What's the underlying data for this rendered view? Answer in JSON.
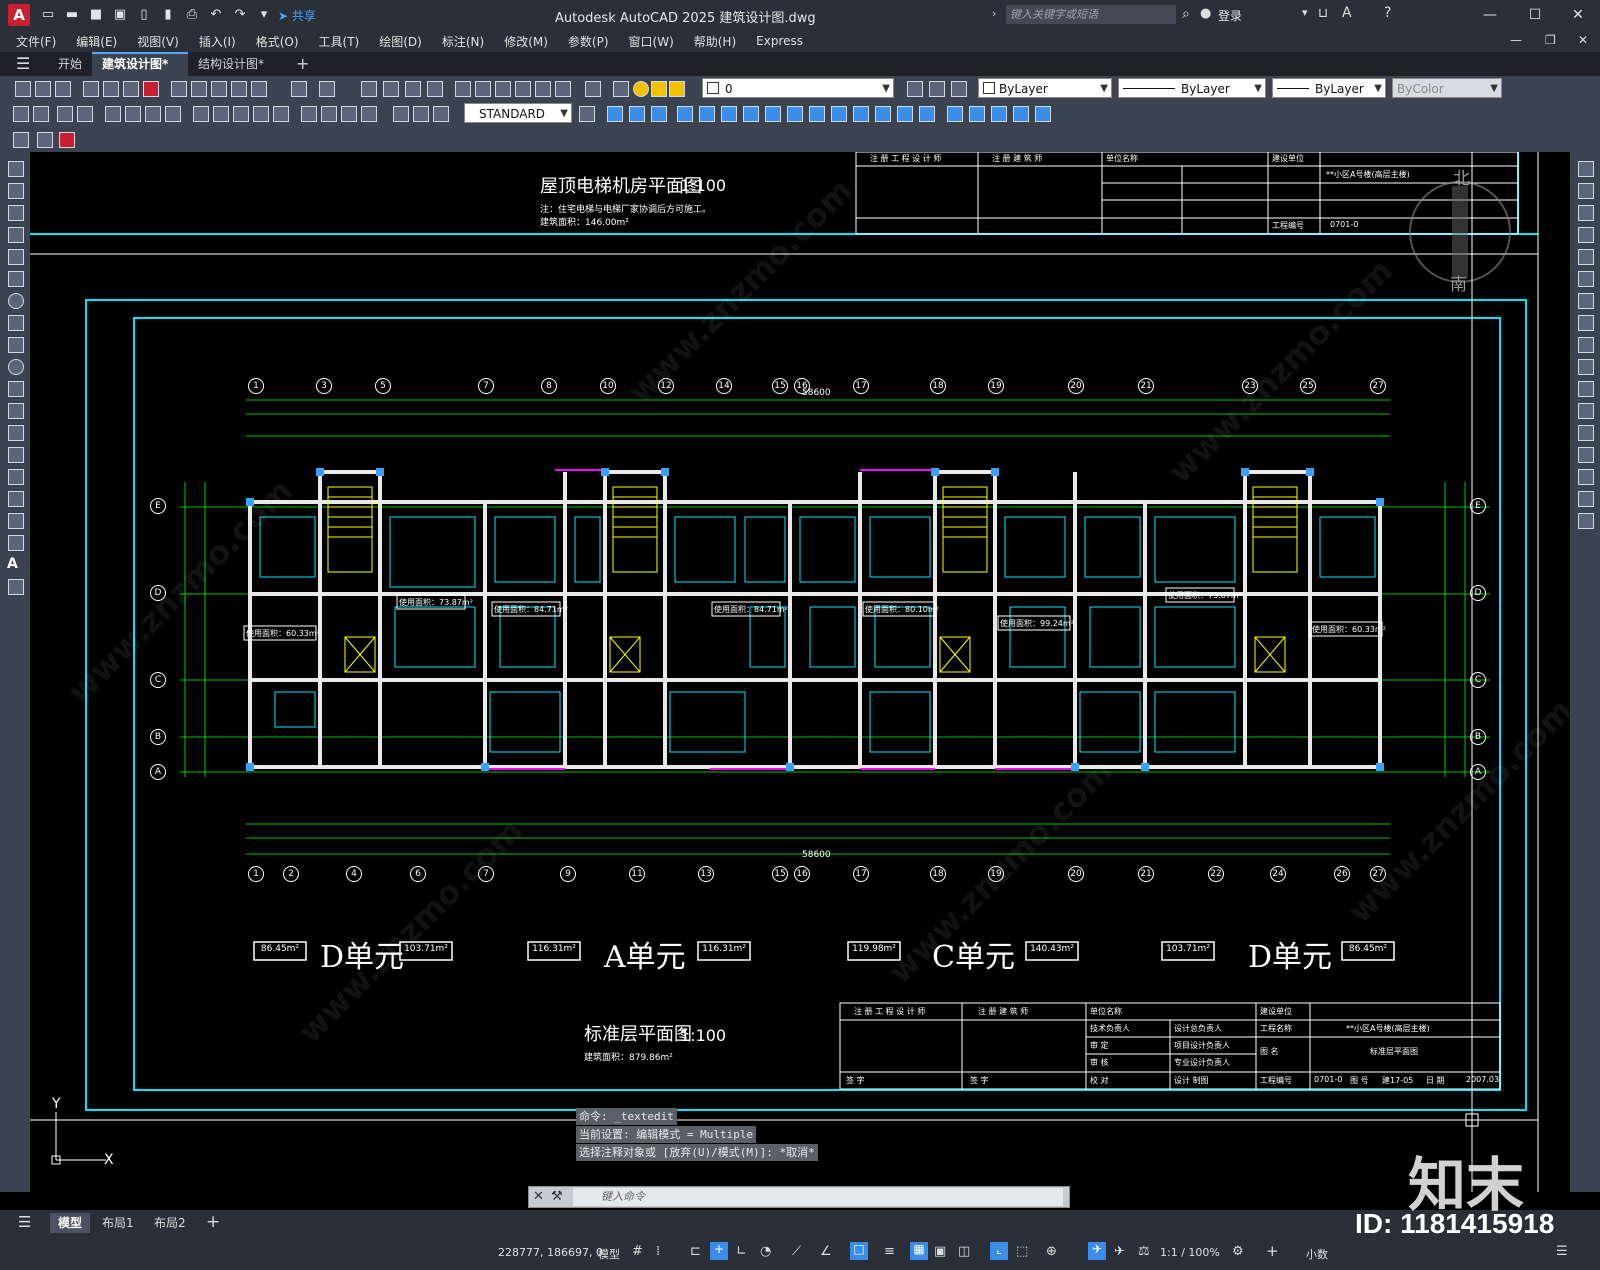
{
  "titlebar": {
    "app_logo": "A",
    "share": "共享",
    "title": "Autodesk AutoCAD 2025    建筑设计图.dwg",
    "search_placeholder": "键入关键字或短语",
    "login": "登录"
  },
  "menu": [
    "文件(F)",
    "编辑(E)",
    "视图(V)",
    "插入(I)",
    "格式(O)",
    "工具(T)",
    "绘图(D)",
    "标注(N)",
    "修改(M)",
    "参数(P)",
    "窗口(W)",
    "帮助(H)",
    "Express"
  ],
  "tabs": {
    "start": "开始",
    "doc1": "建筑设计图*",
    "doc2": "结构设计图*",
    "close": "✕",
    "add": "+"
  },
  "toolbar": {
    "layer_value": "0",
    "textstyle": "STANDARD",
    "color": "ByLayer",
    "linetype": "ByLayer",
    "lineweight": "ByLayer",
    "plotstyle": "ByColor"
  },
  "drawing": {
    "roof_title": "屋顶电梯机房平面图",
    "roof_scale": "1:100",
    "roof_note": "注：住宅电梯与电梯厂家协调后方可施工。",
    "roof_area": "建筑面积：146.00m²",
    "std_title": "标准层平面图",
    "std_scale": "1:100",
    "std_area": "建筑面积：879.86m²",
    "compass_n": "北",
    "compass_s": "南",
    "total_dim": "58600",
    "grid_top": [
      "1",
      "3",
      "5",
      "7",
      "8",
      "10",
      "12",
      "14",
      "15",
      "16",
      "17",
      "18",
      "19",
      "20",
      "21",
      "23",
      "25",
      "27"
    ],
    "grid_bottom": [
      "1",
      "2",
      "4",
      "6",
      "7",
      "9",
      "11",
      "13",
      "15",
      "16",
      "17",
      "18",
      "19",
      "20",
      "21",
      "22",
      "24",
      "26",
      "27"
    ],
    "grid_rows": [
      "E",
      "D",
      "C",
      "B",
      "A"
    ],
    "units": [
      {
        "left_area": "86.45m²",
        "name": "D单元",
        "right_area": "103.71m²"
      },
      {
        "left_area": "116.31m²",
        "name": "A单元",
        "right_area": "116.31m²"
      },
      {
        "left_area": "119.98m²",
        "name": "C单元",
        "right_area": "140.43m²"
      },
      {
        "left_area": "103.71m²",
        "name": "D单元",
        "right_area": "86.45m²"
      }
    ],
    "room_areas": [
      "使用面积：73.87m²",
      "使用面积：84.71m²",
      "使用面积：84.71m²",
      "使用面积：80.10m²",
      "使用面积：99.24m²",
      "使用面积：73.87m²",
      "使用面积：60.33m²",
      "使用面积：60.33m²"
    ],
    "titleblock": {
      "c1": "注 册 工 程 设 计 师",
      "c2": "注 册 建 筑 师",
      "c3": "单位名称",
      "c4": "建设单位",
      "r_tech": "技术负责人",
      "r_design": "设计总负责人",
      "r_project": "工程名称",
      "r_project_v": "**小区A号楼(高层主楼)",
      "r_audit": "审 定",
      "r_proj_lead": "项目设计负责人",
      "r_check": "审 核",
      "r_prof_lead": "专业设计负责人",
      "r_name": "图 名",
      "r_name_v": "标准层平面图",
      "r_sign": "签 字",
      "r_proof": "校 对",
      "r_designer": "设计 制图",
      "r_no": "工程编号",
      "r_no_v": "0701-0",
      "r_drawno": "图 号",
      "r_drawno_v": "建17-05",
      "r_date": "日 期",
      "r_date_v": "2007.03"
    }
  },
  "command": {
    "line1": "命令: _textedit",
    "line2": "当前设置: 编辑模式 = Multiple",
    "line3": "选择注释对象或 [放弃(U)/模式(M)]: *取消*",
    "input_placeholder": "键入命令"
  },
  "layouts": [
    "模型",
    "布局1",
    "布局2"
  ],
  "status": {
    "coords": "228777, 186697, 0",
    "model": "模型",
    "scale": "1:1 / 100%",
    "units": "小数"
  },
  "watermark": {
    "brand": "知末",
    "id": "ID: 1181415918",
    "site": "www.znzmo.com"
  }
}
